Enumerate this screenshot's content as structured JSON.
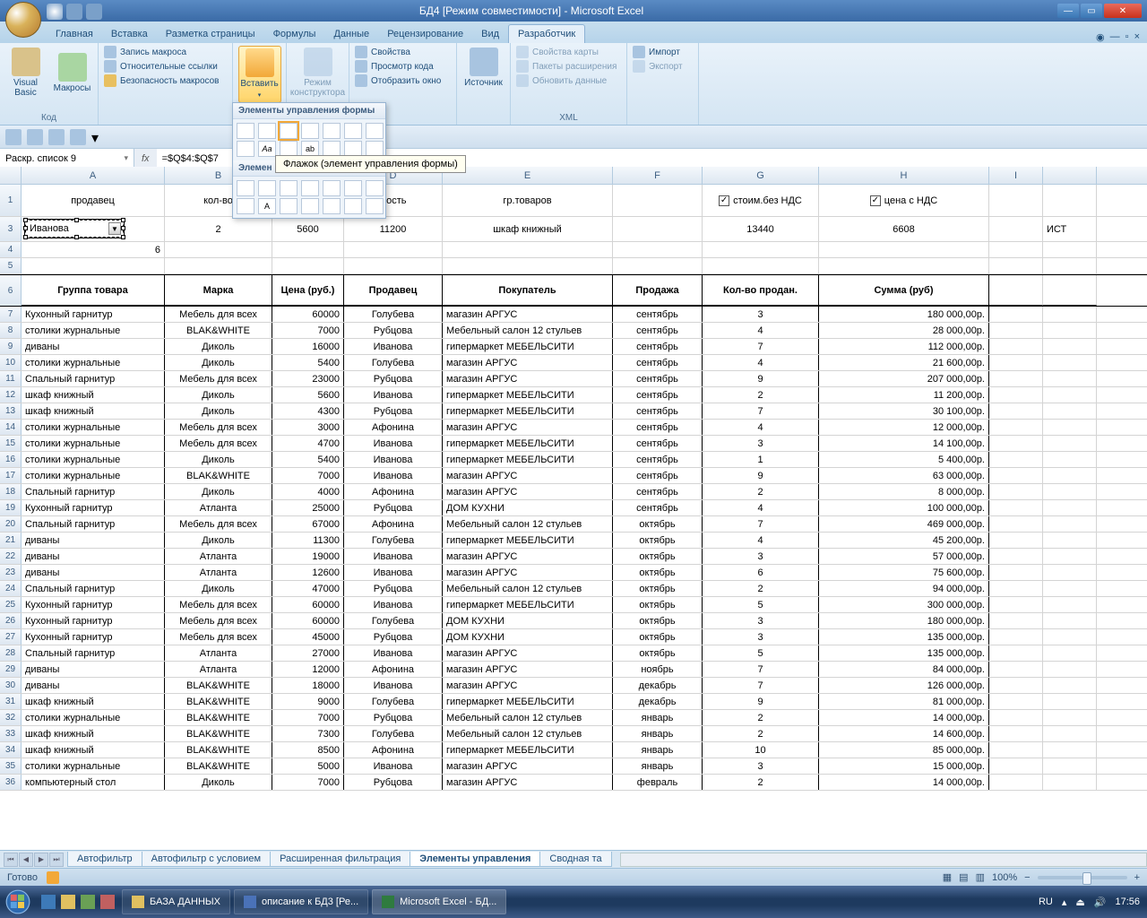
{
  "window": {
    "title": "БД4  [Режим совместимости] - Microsoft Excel"
  },
  "tabs": [
    "Главная",
    "Вставка",
    "Разметка страницы",
    "Формулы",
    "Данные",
    "Рецензирование",
    "Вид",
    "Разработчик"
  ],
  "activeTab": 7,
  "ribbon": {
    "code_group": "Код",
    "visual_basic": "Visual Basic",
    "macros": "Макросы",
    "record_macro": "Запись макроса",
    "relative_refs": "Относительные ссылки",
    "macro_security": "Безопасность макросов",
    "insert": "Вставить",
    "design_mode": "Режим конструктора",
    "properties": "Свойства",
    "view_code": "Просмотр кода",
    "run_dialog": "Отобразить окно",
    "source": "Источник",
    "map_props": "Свойства карты",
    "expansion": "Пакеты расширения",
    "refresh": "Обновить данные",
    "import": "Импорт",
    "export": "Экспорт",
    "xml_group": "XML"
  },
  "dropdown": {
    "title": "Элементы управления формы",
    "tooltip": "Флажок (элемент управления формы)",
    "title2": "Элемен"
  },
  "nameBox": "Раскр. список 9",
  "formula": "=$Q$4:$Q$7",
  "topHeaders": {
    "A": "продавец",
    "B": "кол-во",
    "D": "мость",
    "E": "гр.товаров",
    "G_chk": "стоим.без НДС",
    "H_chk": "цена с НДС"
  },
  "row3": {
    "A_combo": "Иванова",
    "B": "2",
    "C": "5600",
    "D": "11200",
    "E": "шкаф книжный",
    "G": "13440",
    "H": "6608"
  },
  "row4": {
    "A_sub": "6"
  },
  "tableHeaders": [
    "Группа товара",
    "Марка",
    "Цена (руб.)",
    "Продавец",
    "Покупатель",
    "Продажа",
    "Кол-во продан.",
    "Сумма (руб)"
  ],
  "rows": [
    [
      "Кухонный гарнитур",
      "Мебель для всех",
      "60000",
      "Голубева",
      "магазин АРГУС",
      "сентябрь",
      "3",
      "180 000,00р."
    ],
    [
      "столики журнальные",
      "BLAK&WHITE",
      "7000",
      "Рубцова",
      "Мебельный салон 12 стульев",
      "сентябрь",
      "4",
      "28 000,00р."
    ],
    [
      "диваны",
      "Диколь",
      "16000",
      "Иванова",
      "гипермаркет МЕБЕЛЬСИТИ",
      "сентябрь",
      "7",
      "112 000,00р."
    ],
    [
      "столики журнальные",
      "Диколь",
      "5400",
      "Голубева",
      "магазин АРГУС",
      "сентябрь",
      "4",
      "21 600,00р."
    ],
    [
      "Спальный гарнитур",
      "Мебель для всех",
      "23000",
      "Рубцова",
      "магазин АРГУС",
      "сентябрь",
      "9",
      "207 000,00р."
    ],
    [
      "шкаф книжный",
      "Диколь",
      "5600",
      "Иванова",
      "гипермаркет МЕБЕЛЬСИТИ",
      "сентябрь",
      "2",
      "11 200,00р."
    ],
    [
      "шкаф книжный",
      "Диколь",
      "4300",
      "Рубцова",
      "гипермаркет МЕБЕЛЬСИТИ",
      "сентябрь",
      "7",
      "30 100,00р."
    ],
    [
      "столики журнальные",
      "Мебель для всех",
      "3000",
      "Афонина",
      "магазин АРГУС",
      "сентябрь",
      "4",
      "12 000,00р."
    ],
    [
      "столики журнальные",
      "Мебель для всех",
      "4700",
      "Иванова",
      "гипермаркет МЕБЕЛЬСИТИ",
      "сентябрь",
      "3",
      "14 100,00р."
    ],
    [
      "столики журнальные",
      "Диколь",
      "5400",
      "Иванова",
      "гипермаркет МЕБЕЛЬСИТИ",
      "сентябрь",
      "1",
      "5 400,00р."
    ],
    [
      "столики журнальные",
      "BLAK&WHITE",
      "7000",
      "Иванова",
      "магазин АРГУС",
      "сентябрь",
      "9",
      "63 000,00р."
    ],
    [
      "Спальный гарнитур",
      "Диколь",
      "4000",
      "Афонина",
      "магазин АРГУС",
      "сентябрь",
      "2",
      "8 000,00р."
    ],
    [
      "Кухонный гарнитур",
      "Атланта",
      "25000",
      "Рубцова",
      "ДОМ КУХНИ",
      "сентябрь",
      "4",
      "100 000,00р."
    ],
    [
      "Спальный гарнитур",
      "Мебель для всех",
      "67000",
      "Афонина",
      "Мебельный салон 12 стульев",
      "октябрь",
      "7",
      "469 000,00р."
    ],
    [
      "диваны",
      "Диколь",
      "11300",
      "Голубева",
      "гипермаркет МЕБЕЛЬСИТИ",
      "октябрь",
      "4",
      "45 200,00р."
    ],
    [
      "диваны",
      "Атланта",
      "19000",
      "Иванова",
      "магазин АРГУС",
      "октябрь",
      "3",
      "57 000,00р."
    ],
    [
      "диваны",
      "Атланта",
      "12600",
      "Иванова",
      "магазин АРГУС",
      "октябрь",
      "6",
      "75 600,00р."
    ],
    [
      "Спальный гарнитур",
      "Диколь",
      "47000",
      "Рубцова",
      "Мебельный салон 12 стульев",
      "октябрь",
      "2",
      "94 000,00р."
    ],
    [
      "Кухонный гарнитур",
      "Мебель для всех",
      "60000",
      "Иванова",
      "гипермаркет МЕБЕЛЬСИТИ",
      "октябрь",
      "5",
      "300 000,00р."
    ],
    [
      "Кухонный гарнитур",
      "Мебель для всех",
      "60000",
      "Голубева",
      "ДОМ КУХНИ",
      "октябрь",
      "3",
      "180 000,00р."
    ],
    [
      "Кухонный гарнитур",
      "Мебель для всех",
      "45000",
      "Рубцова",
      "ДОМ КУХНИ",
      "октябрь",
      "3",
      "135 000,00р."
    ],
    [
      "Спальный гарнитур",
      "Атланта",
      "27000",
      "Иванова",
      "магазин АРГУС",
      "октябрь",
      "5",
      "135 000,00р."
    ],
    [
      "диваны",
      "Атланта",
      "12000",
      "Афонина",
      "магазин АРГУС",
      "ноябрь",
      "7",
      "84 000,00р."
    ],
    [
      "диваны",
      "BLAK&WHITE",
      "18000",
      "Иванова",
      "магазин АРГУС",
      "декабрь",
      "7",
      "126 000,00р."
    ],
    [
      "шкаф книжный",
      "BLAK&WHITE",
      "9000",
      "Голубева",
      "гипермаркет МЕБЕЛЬСИТИ",
      "декабрь",
      "9",
      "81 000,00р."
    ],
    [
      "столики журнальные",
      "BLAK&WHITE",
      "7000",
      "Рубцова",
      "Мебельный салон 12 стульев",
      "январь",
      "2",
      "14 000,00р."
    ],
    [
      "шкаф книжный",
      "BLAK&WHITE",
      "7300",
      "Голубева",
      "Мебельный салон 12 стульев",
      "январь",
      "2",
      "14 600,00р."
    ],
    [
      "шкаф книжный",
      "BLAK&WHITE",
      "8500",
      "Афонина",
      "гипермаркет МЕБЕЛЬСИТИ",
      "январь",
      "10",
      "85 000,00р."
    ],
    [
      "столики журнальные",
      "BLAK&WHITE",
      "5000",
      "Иванова",
      "магазин АРГУС",
      "январь",
      "3",
      "15 000,00р."
    ],
    [
      "компьютерный стол",
      "Диколь",
      "7000",
      "Рубцова",
      "магазин АРГУС",
      "февраль",
      "2",
      "14 000,00р."
    ]
  ],
  "sheetTabs": [
    "Автофильтр",
    "Автофильтр с условием",
    "Расширенная фильтрация",
    "Элементы управления",
    "Сводная та"
  ],
  "activeSheetTab": 3,
  "status": {
    "ready": "Готово",
    "zoom": "100%",
    "lang": "RU",
    "time": "17:56"
  },
  "taskbar": {
    "app1": "БАЗА ДАННЫХ",
    "app2": "описание к БД3 [Ре...",
    "app3": "Microsoft Excel - БД..."
  },
  "extraCell": "ИСТ"
}
